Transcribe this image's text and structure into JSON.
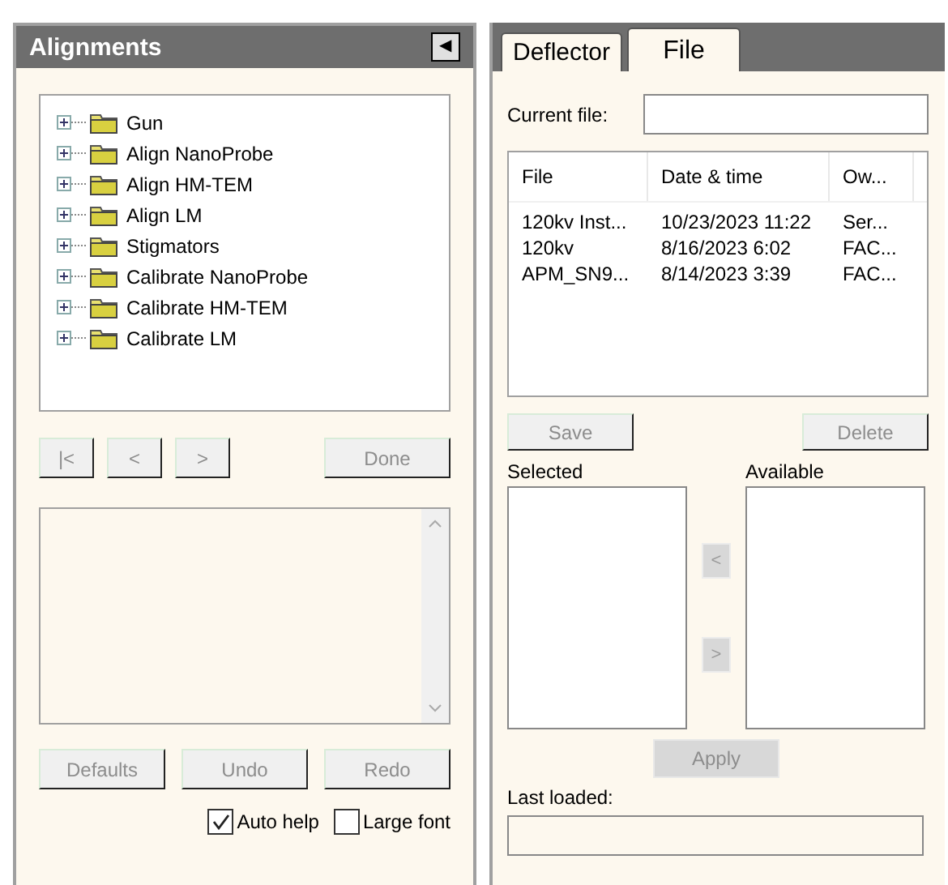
{
  "alignments": {
    "title": "Alignments",
    "collapse_glyph": "◀",
    "tree": [
      {
        "label": "Gun",
        "expanded": false
      },
      {
        "label": "Align NanoProbe",
        "expanded": false
      },
      {
        "label": "Align HM-TEM",
        "expanded": false
      },
      {
        "label": "Align LM",
        "expanded": false
      },
      {
        "label": "Stigmators",
        "expanded": false
      },
      {
        "label": "Calibrate NanoProbe",
        "expanded": false
      },
      {
        "label": "Calibrate HM-TEM",
        "expanded": false
      },
      {
        "label": "Calibrate LM",
        "expanded": false
      }
    ],
    "nav_buttons": [
      {
        "label": "|<",
        "disabled": true
      },
      {
        "label": "<",
        "disabled": true
      },
      {
        "label": ">",
        "disabled": true
      }
    ],
    "done_button": {
      "label": "Done",
      "disabled": true
    },
    "action_buttons": [
      {
        "label": "Defaults",
        "disabled": true
      },
      {
        "label": "Undo",
        "disabled": true
      },
      {
        "label": "Redo",
        "disabled": true
      }
    ],
    "options": [
      {
        "label": "Auto help",
        "checked": true
      },
      {
        "label": "Large font",
        "checked": false
      }
    ]
  },
  "file_panel": {
    "tabs": [
      {
        "label": "Deflector",
        "selected": false
      },
      {
        "label": "File",
        "selected": true
      }
    ],
    "current_file_label": "Current file:",
    "table": {
      "columns": [
        "File",
        "Date & time",
        "Ow..."
      ],
      "rows": [
        [
          "120kv Inst...",
          "10/23/2023 11:22",
          "Ser..."
        ],
        [
          "120kv",
          "8/16/2023  6:02",
          "FAC..."
        ],
        [
          "APM_SN9...",
          "8/14/2023  3:39",
          "FAC..."
        ]
      ]
    },
    "save_button": {
      "label": "Save",
      "disabled": true
    },
    "delete_button": {
      "label": "Delete",
      "disabled": true
    },
    "selected_label": "Selected",
    "available_label": "Available",
    "move_buttons": [
      {
        "label": "<",
        "disabled": true
      },
      {
        "label": ">",
        "disabled": true
      }
    ],
    "apply_button": {
      "label": "Apply",
      "disabled": true
    },
    "last_loaded_label": "Last loaded:"
  }
}
